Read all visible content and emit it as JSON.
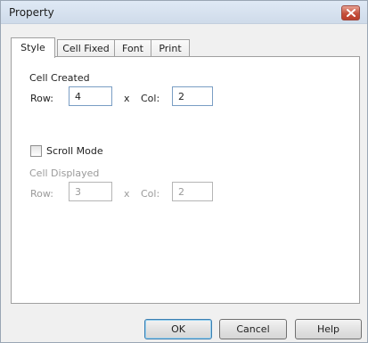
{
  "window": {
    "title": "Property",
    "close_icon": "close-icon",
    "accent_color": "#c5513d"
  },
  "tabs": [
    {
      "label": "Style",
      "active": true
    },
    {
      "label": "Cell Fixed",
      "active": false
    },
    {
      "label": "Font",
      "active": false
    },
    {
      "label": "Print",
      "active": false
    }
  ],
  "style_tab": {
    "cell_created": {
      "heading": "Cell Created",
      "row_label": "Row:",
      "row_value": "4",
      "x_label": "x",
      "col_label": "Col:",
      "col_value": "2"
    },
    "scroll_mode": {
      "label": "Scroll Mode",
      "checked": false
    },
    "cell_displayed": {
      "heading": "Cell Displayed",
      "row_label": "Row:",
      "row_value": "3",
      "x_label": "x",
      "col_label": "Col:",
      "col_value": "2",
      "enabled": false
    }
  },
  "buttons": {
    "ok": "OK",
    "cancel": "Cancel",
    "help": "Help"
  }
}
